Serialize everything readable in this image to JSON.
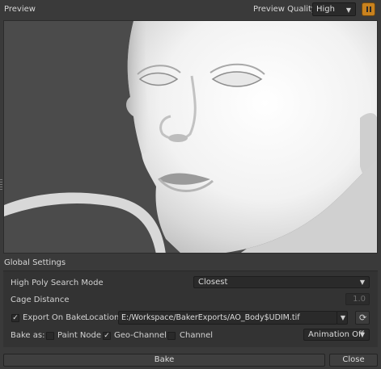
{
  "header": {
    "title": "Preview",
    "quality_label": "Preview Quality",
    "quality_value": "High",
    "pause_icon": "pause-icon"
  },
  "colors": {
    "accent": "#c9821e",
    "background": "#3a3a3a",
    "viewport_bg": "#4b4b4b"
  },
  "global_settings": {
    "title": "Global Settings",
    "high_poly_search_mode": {
      "label": "High Poly Search Mode",
      "value": "Closest"
    },
    "cage_distance": {
      "label": "Cage Distance",
      "value": "1.0"
    },
    "export_on_bake": {
      "label": "Export On Bake",
      "checked": true,
      "location_label": "Location",
      "location_value": "E:/Workspace/BakerExports/AO_Body$UDIM.tif",
      "refresh_icon": "refresh-icon"
    },
    "bake_as": {
      "label": "Bake as:",
      "options": [
        {
          "label": "Paint Node",
          "checked": false
        },
        {
          "label": "Geo-Channel",
          "checked": true
        },
        {
          "label": "Channel",
          "checked": false
        }
      ],
      "animation_value": "Animation Off"
    }
  },
  "footer": {
    "bake_label": "Bake",
    "close_label": "Close"
  }
}
